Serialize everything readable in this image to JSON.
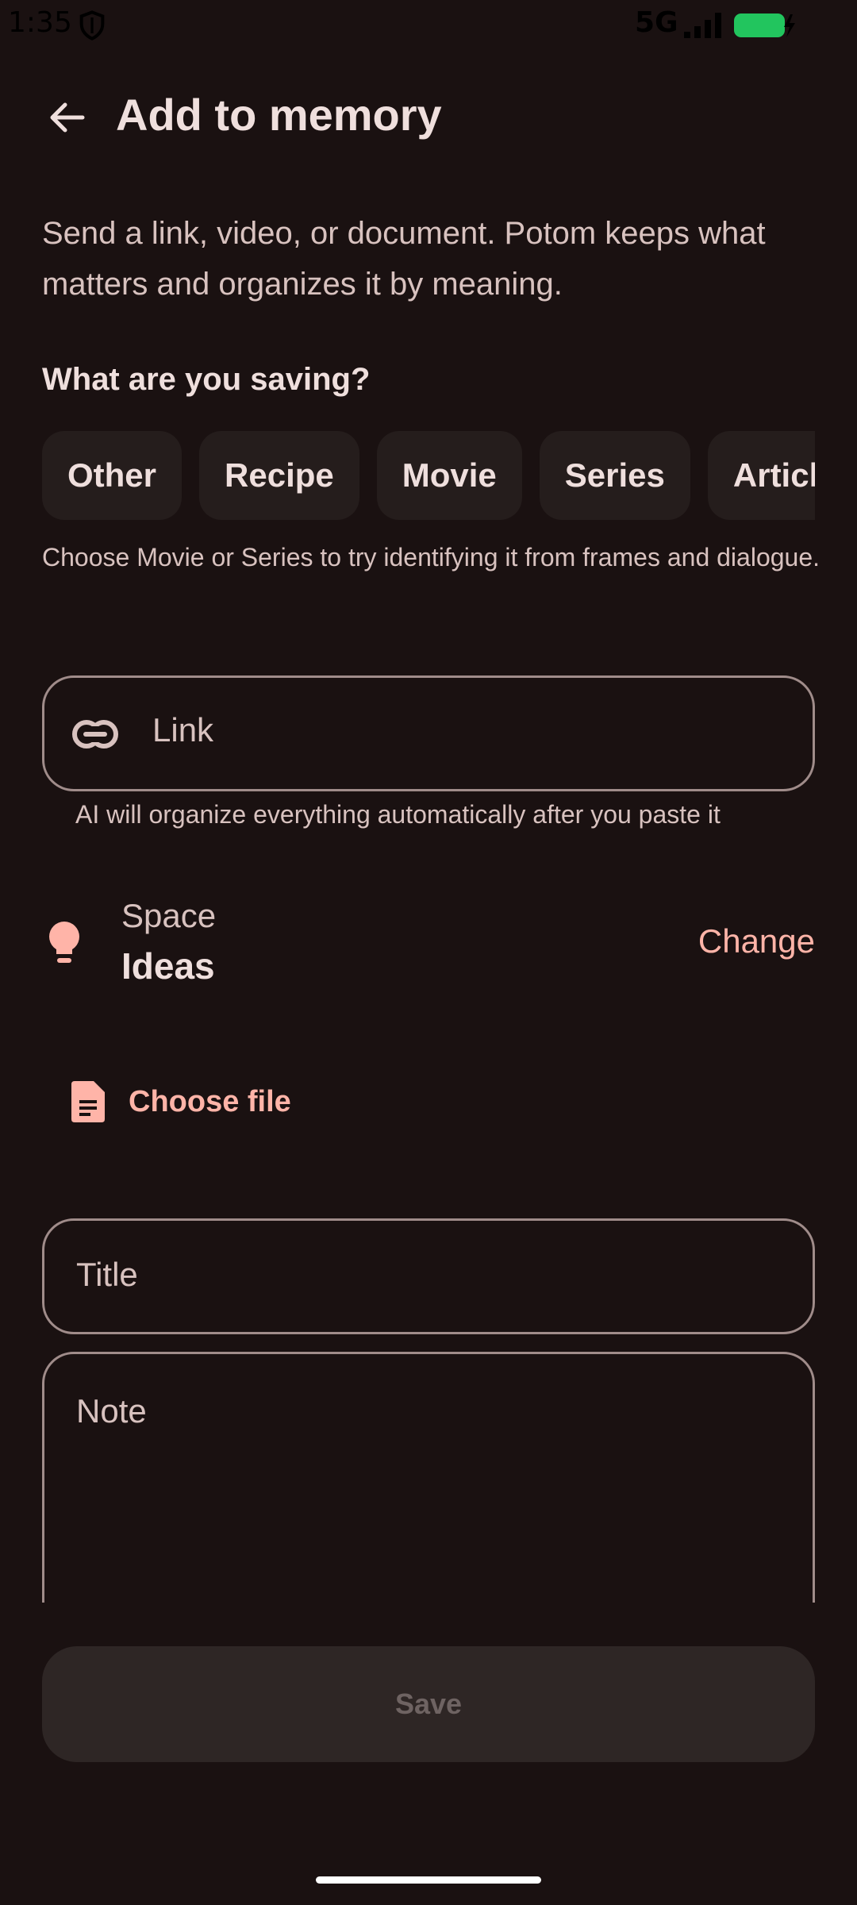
{
  "status_bar": {
    "time": "1:35",
    "network": "5G",
    "battery_color": "#22c55e"
  },
  "header": {
    "title": "Add to memory"
  },
  "intro_text": "Send a link, video, or document. Potom keeps what matters and organizes it by meaning.",
  "category": {
    "label": "What are you saving?",
    "chips": [
      {
        "label": "Other"
      },
      {
        "label": "Recipe"
      },
      {
        "label": "Movie"
      },
      {
        "label": "Series"
      },
      {
        "label": "Article"
      }
    ],
    "hint": "Choose Movie or Series to try identifying it from frames and dialogue."
  },
  "link_field": {
    "placeholder": "Link",
    "support_text": "AI will organize everything automatically after you paste it"
  },
  "space": {
    "label": "Space",
    "value": "Ideas",
    "change_label": "Change"
  },
  "choose_file_label": "Choose file",
  "title_field": {
    "placeholder": "Title"
  },
  "note_field": {
    "placeholder": "Note"
  },
  "save_label": "Save",
  "colors": {
    "background": "#1a1111",
    "accent": "#ffb4a8",
    "outline": "#a08c8a",
    "chip_bg": "#251d1c",
    "disabled_bg": "#2e2625"
  }
}
